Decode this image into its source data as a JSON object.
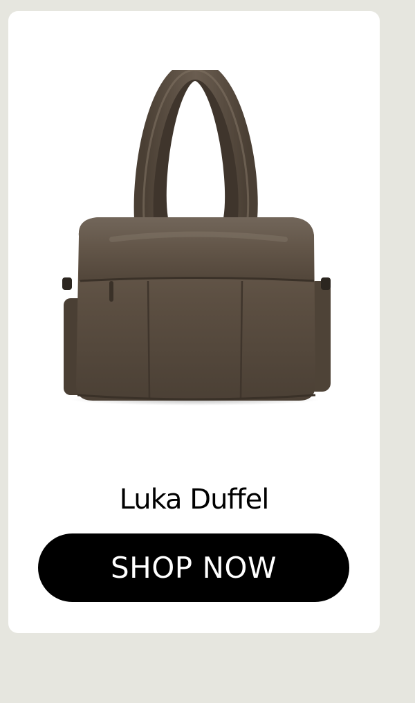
{
  "product": {
    "name": "Luka Duffel",
    "image_icon": "duffel-bag-image",
    "bag_color": "#5a4c3f"
  },
  "cta": {
    "label": "SHOP NOW"
  },
  "colors": {
    "background": "#e6e6df",
    "card": "#ffffff",
    "button": "#000000",
    "button_text": "#ffffff"
  }
}
